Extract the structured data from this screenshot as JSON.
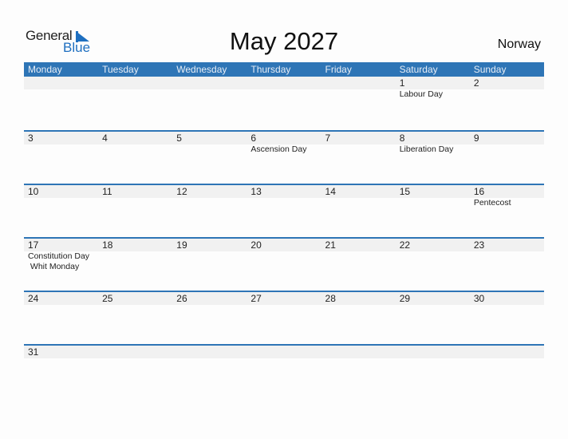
{
  "logo": {
    "word1": "General",
    "word2": "Blue"
  },
  "title": "May 2027",
  "country": "Norway",
  "colors": {
    "accent": "#2e75b6",
    "strip": "#f1f1f1",
    "logo_blue": "#1e6fc0"
  },
  "weekdays": [
    "Monday",
    "Tuesday",
    "Wednesday",
    "Thursday",
    "Friday",
    "Saturday",
    "Sunday"
  ],
  "weeks": [
    [
      {
        "d": ""
      },
      {
        "d": ""
      },
      {
        "d": ""
      },
      {
        "d": ""
      },
      {
        "d": ""
      },
      {
        "d": "1",
        "h": [
          "Labour Day"
        ]
      },
      {
        "d": "2"
      }
    ],
    [
      {
        "d": "3"
      },
      {
        "d": "4"
      },
      {
        "d": "5"
      },
      {
        "d": "6",
        "h": [
          "Ascension Day"
        ]
      },
      {
        "d": "7"
      },
      {
        "d": "8",
        "h": [
          "Liberation Day"
        ]
      },
      {
        "d": "9"
      }
    ],
    [
      {
        "d": "10"
      },
      {
        "d": "11"
      },
      {
        "d": "12"
      },
      {
        "d": "13"
      },
      {
        "d": "14"
      },
      {
        "d": "15"
      },
      {
        "d": "16",
        "h": [
          "Pentecost"
        ]
      }
    ],
    [
      {
        "d": "17",
        "h": [
          "Constitution Day",
          " Whit Monday"
        ]
      },
      {
        "d": "18"
      },
      {
        "d": "19"
      },
      {
        "d": "20"
      },
      {
        "d": "21"
      },
      {
        "d": "22"
      },
      {
        "d": "23"
      }
    ],
    [
      {
        "d": "24"
      },
      {
        "d": "25"
      },
      {
        "d": "26"
      },
      {
        "d": "27"
      },
      {
        "d": "28"
      },
      {
        "d": "29"
      },
      {
        "d": "30"
      }
    ],
    [
      {
        "d": "31"
      },
      {
        "d": ""
      },
      {
        "d": ""
      },
      {
        "d": ""
      },
      {
        "d": ""
      },
      {
        "d": ""
      },
      {
        "d": ""
      }
    ]
  ]
}
